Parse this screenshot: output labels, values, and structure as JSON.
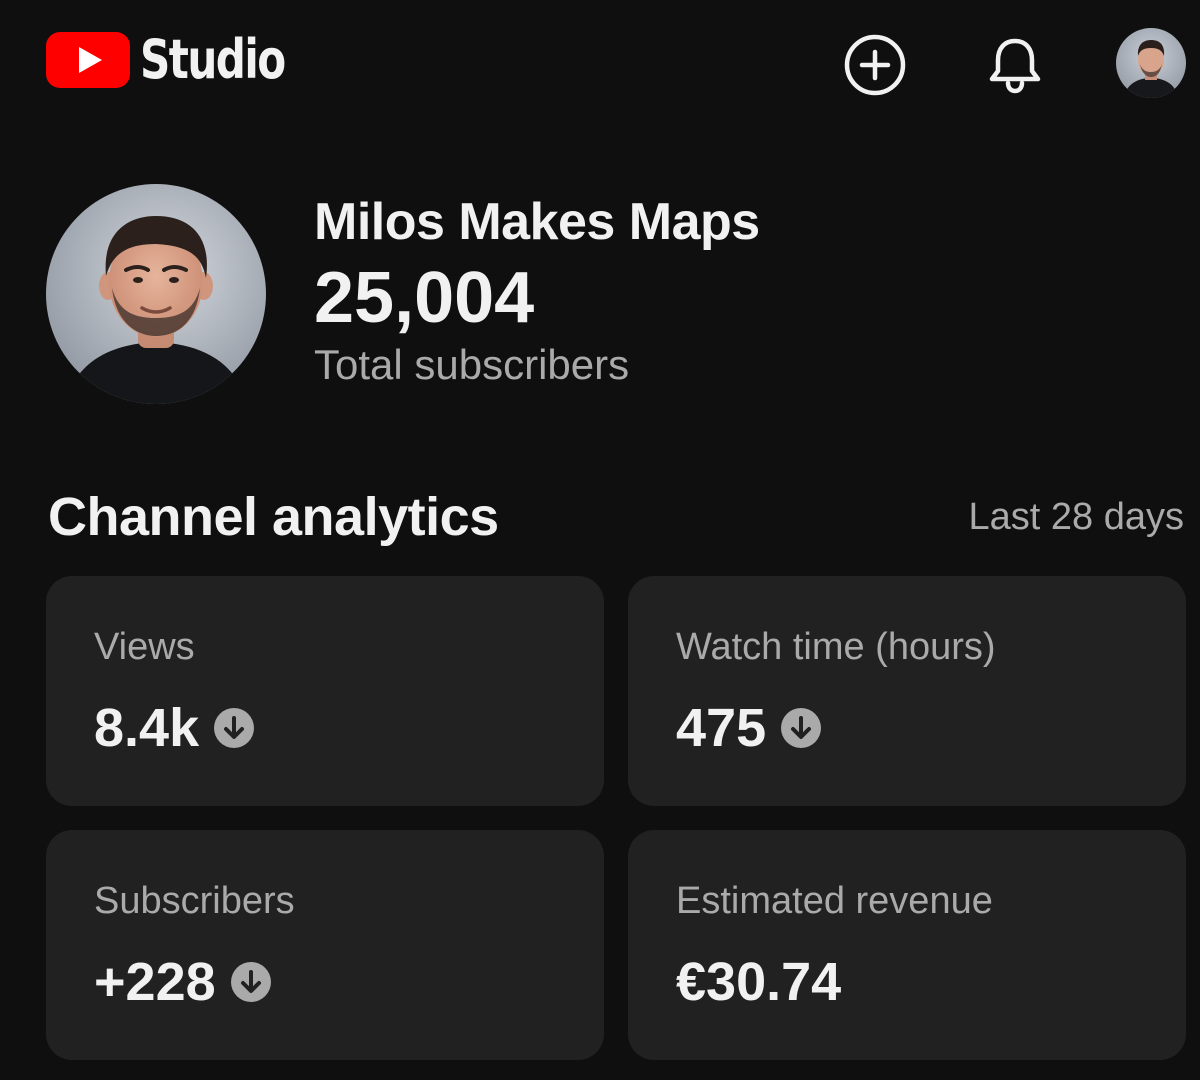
{
  "header": {
    "brand_text": "Studio",
    "brand_color": "#ff0000",
    "create_icon": "add-circle-icon",
    "notifications_icon": "bell-icon",
    "account_avatar": "account-avatar"
  },
  "channel": {
    "name": "Milos Makes Maps",
    "subscribers": "25,004",
    "subscribers_caption": "Total subscribers"
  },
  "analytics": {
    "title": "Channel analytics",
    "period": "Last 28 days",
    "cards": [
      {
        "label": "Views",
        "value": "8.4k",
        "trend": "down"
      },
      {
        "label": "Watch time (hours)",
        "value": "475",
        "trend": "down"
      },
      {
        "label": "Subscribers",
        "value": "+228",
        "trend": "down"
      },
      {
        "label": "Estimated revenue",
        "value": "€30.74",
        "trend": "none"
      }
    ]
  },
  "colors": {
    "background": "#0f0f0f",
    "card_background": "#212121",
    "text_primary": "#f1f1f1",
    "text_secondary": "#aaaaaa",
    "trend_icon": "#aaaaaa"
  }
}
